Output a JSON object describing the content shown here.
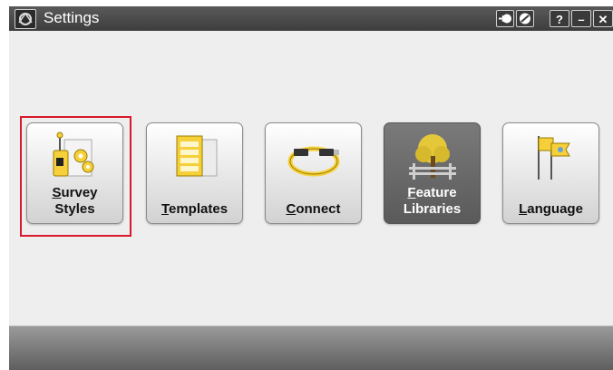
{
  "window": {
    "title": "Settings",
    "title_buttons": {
      "help": "?",
      "minimize": "–",
      "close": "✕"
    }
  },
  "tiles": [
    {
      "line1_first": "S",
      "line1_rest": "urvey",
      "line2": "Styles",
      "selected": true,
      "icon": "survey-styles-icon"
    },
    {
      "first": "T",
      "rest": "emplates",
      "icon": "templates-icon"
    },
    {
      "first": "C",
      "rest": "onnect",
      "icon": "connect-cable-icon"
    },
    {
      "line1_first": "F",
      "line1_rest": "eature",
      "line2": "Libraries",
      "disabled": true,
      "icon": "feature-tree-icon"
    },
    {
      "first": "L",
      "rest": "anguage",
      "icon": "language-flags-icon"
    }
  ],
  "colors": {
    "title_bar": "#454545",
    "content_bg": "#eeeeee",
    "selection_outline": "#d7192a",
    "tile_dark": "#666666"
  }
}
